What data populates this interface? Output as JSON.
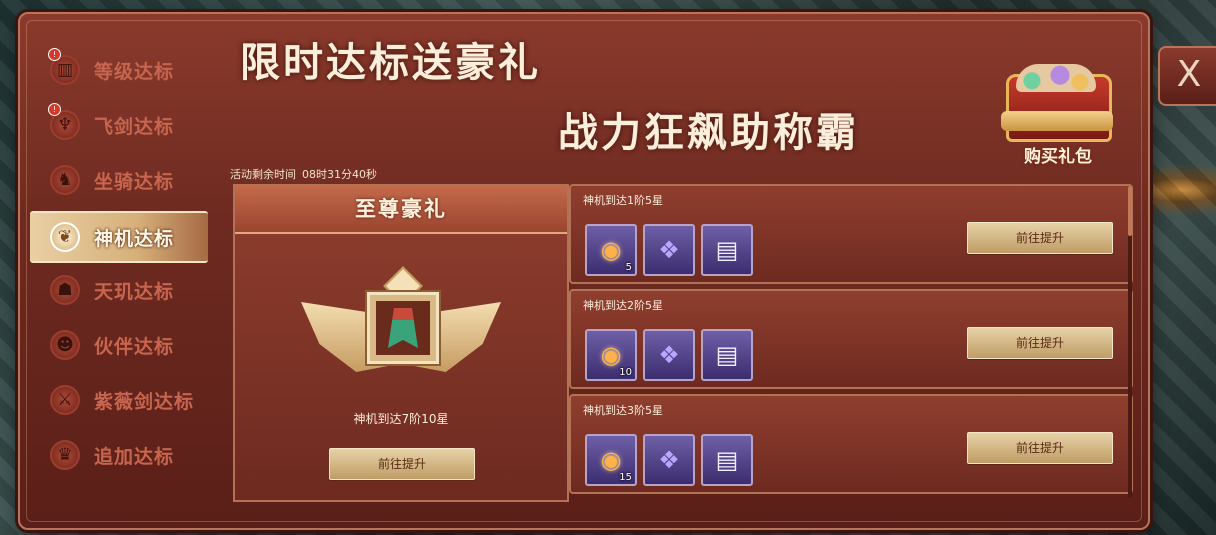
{
  "sidebar": {
    "items": [
      {
        "label": "等级达标",
        "icon": "castle-icon",
        "glyph": "▥",
        "badge": "!"
      },
      {
        "label": "飞剑达标",
        "icon": "winged-emblem-icon",
        "glyph": "♆",
        "badge": "!"
      },
      {
        "label": "坐骑达标",
        "icon": "horse-head-icon",
        "glyph": "♞",
        "badge": ""
      },
      {
        "label": "神机达标",
        "icon": "mech-wing-icon",
        "glyph": "❦",
        "badge": "",
        "active": true
      },
      {
        "label": "天玑达标",
        "icon": "demon-mask-icon",
        "glyph": "☗",
        "badge": ""
      },
      {
        "label": "伙伴达标",
        "icon": "companion-face-icon",
        "glyph": "☻",
        "badge": ""
      },
      {
        "label": "紫薇剑达标",
        "icon": "sword-crest-icon",
        "glyph": "⚔",
        "badge": ""
      },
      {
        "label": "追加达标",
        "icon": "crown-icon",
        "glyph": "♛",
        "badge": ""
      }
    ]
  },
  "header": {
    "title_line1": "限时达标送豪礼",
    "title_line2": "战力狂飙助称霸",
    "gift_label": "购买礼包",
    "close_glyph": "X"
  },
  "timer": {
    "label": "活动剩余时间",
    "value": "08时31分40秒"
  },
  "grand_prize": {
    "title": "至尊豪礼",
    "description": "神机到达7阶10星",
    "button": "前往提升"
  },
  "rewards": [
    {
      "title": "神机到达1阶5星",
      "button": "前往提升",
      "items": [
        {
          "icon": "golden-orb-icon",
          "glyph": "◉",
          "kind": "orb",
          "qty": "5"
        },
        {
          "icon": "purple-book-icon",
          "glyph": "❖",
          "kind": "book",
          "qty": ""
        },
        {
          "icon": "scroll-cards-icon",
          "glyph": "▤",
          "kind": "scroll",
          "qty": ""
        }
      ]
    },
    {
      "title": "神机到达2阶5星",
      "button": "前往提升",
      "items": [
        {
          "icon": "golden-orb-icon",
          "glyph": "◉",
          "kind": "orb",
          "qty": "10"
        },
        {
          "icon": "purple-book-icon",
          "glyph": "❖",
          "kind": "book",
          "qty": ""
        },
        {
          "icon": "scroll-cards-icon",
          "glyph": "▤",
          "kind": "scroll",
          "qty": ""
        }
      ]
    },
    {
      "title": "神机到达3阶5星",
      "button": "前往提升",
      "items": [
        {
          "icon": "golden-orb-icon",
          "glyph": "◉",
          "kind": "orb",
          "qty": "15"
        },
        {
          "icon": "purple-book-icon",
          "glyph": "❖",
          "kind": "book",
          "qty": ""
        },
        {
          "icon": "scroll-cards-icon",
          "glyph": "▤",
          "kind": "scroll",
          "qty": ""
        }
      ]
    }
  ]
}
